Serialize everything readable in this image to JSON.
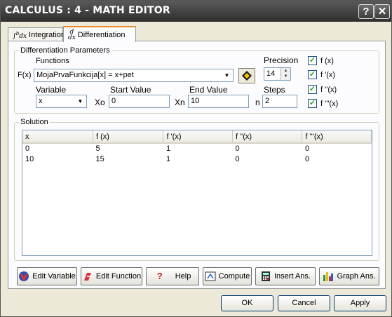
{
  "window": {
    "title": "CALCULUS : 4 - MATH EDITOR",
    "help_glyph": "?",
    "close_glyph": "✕"
  },
  "tabs": [
    {
      "label": "Integration",
      "icon": "integral-icon"
    },
    {
      "label": "Differentiation",
      "icon": "derivative-icon"
    }
  ],
  "params": {
    "group_label": "Differentiation Parameters",
    "functions_label": "Functions",
    "fx_label": "F(x)",
    "function_value": "MojaPrvaFunkcija[x] = x+pet",
    "precision_label": "Precision",
    "precision_value": "14",
    "variable_label": "Variable",
    "variable_value": "x",
    "x0_prefix": "Xo",
    "start_label": "Start Value",
    "start_value": "0",
    "xn_prefix": "Xn",
    "end_label": "End Value",
    "end_value": "10",
    "n_prefix": "n",
    "steps_label": "Steps",
    "steps_value": "2",
    "checks": [
      {
        "label": "f (x)",
        "checked": true
      },
      {
        "label": "f '(x)",
        "checked": true
      },
      {
        "label": "f ''(x)",
        "checked": true
      },
      {
        "label": "f '''(x)",
        "checked": true
      }
    ]
  },
  "solution": {
    "group_label": "Solution",
    "columns": [
      "x",
      "f (x)",
      "f '(x)",
      "f ''(x)",
      "f '''(x)"
    ],
    "rows": [
      [
        "0",
        "5",
        "1",
        "0",
        "0"
      ],
      [
        "10",
        "15",
        "1",
        "0",
        "0"
      ]
    ]
  },
  "toolbar": {
    "edit_variable": "Edit Variable",
    "edit_function": "Edit Function",
    "help": "Help",
    "compute": "Compute",
    "insert_ans": "Insert Ans.",
    "graph_ans": "Graph Ans."
  },
  "dialog": {
    "ok": "OK",
    "cancel": "Cancel",
    "apply": "Apply"
  }
}
